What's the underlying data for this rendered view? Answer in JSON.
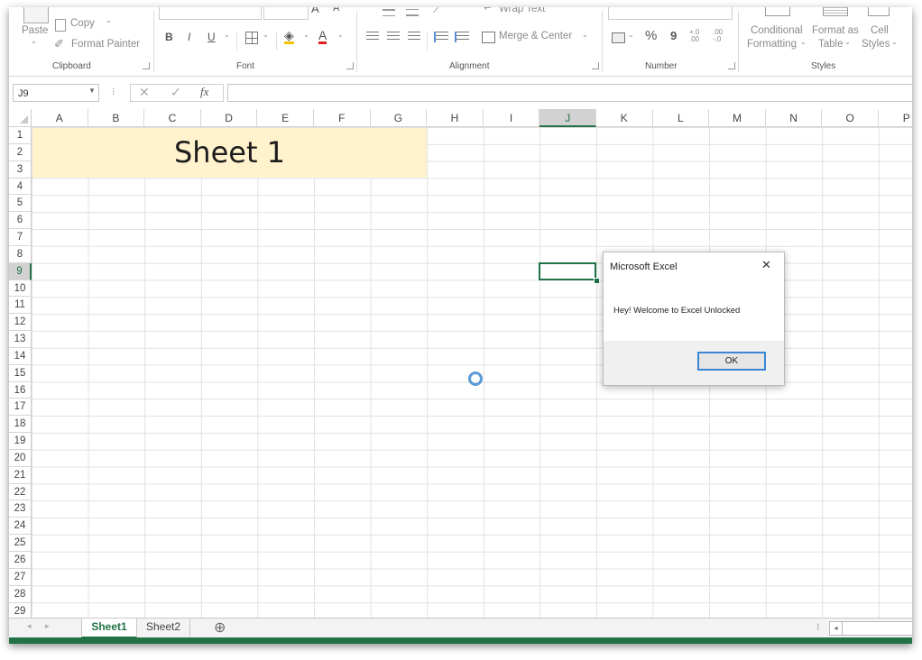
{
  "ribbon": {
    "clipboard": {
      "paste": "Paste",
      "copy": "Copy",
      "format_painter": "Format Painter",
      "group": "Clipboard"
    },
    "font": {
      "bold": "B",
      "italic": "I",
      "underline": "U",
      "group": "Font"
    },
    "alignment": {
      "wrap_text": "Wrap Text",
      "merge_center": "Merge & Center",
      "group": "Alignment"
    },
    "number": {
      "percent": "%",
      "comma": "9",
      "inc_decimal": "+.0 .00",
      "dec_decimal": ".00 -.0",
      "group": "Number"
    },
    "styles": {
      "conditional_l1": "Conditional",
      "conditional_l2": "Formatting",
      "format_table_l1": "Format as",
      "format_table_l2": "Table",
      "cell_styles_l1": "Cell",
      "cell_styles_l2": "Styles",
      "group": "Styles"
    }
  },
  "formula_bar": {
    "name_box": "J9",
    "fx": "fx",
    "formula": ""
  },
  "columns": [
    "A",
    "B",
    "C",
    "D",
    "E",
    "F",
    "G",
    "H",
    "I",
    "J",
    "K",
    "L",
    "M",
    "N",
    "O",
    "P"
  ],
  "rows": [
    "1",
    "2",
    "3",
    "4",
    "5",
    "6",
    "7",
    "8",
    "9",
    "10",
    "11",
    "12",
    "13",
    "14",
    "15",
    "16",
    "17",
    "18",
    "19",
    "20",
    "21",
    "22",
    "23",
    "24",
    "25",
    "26",
    "27",
    "28",
    "29"
  ],
  "selected_cell": {
    "column": "J",
    "row": "9"
  },
  "merged_title": {
    "text": "Sheet 1",
    "fill": "#fff2cc"
  },
  "dialog": {
    "title": "Microsoft Excel",
    "close": "✕",
    "message": "Hey! Welcome to Excel Unlocked",
    "ok": "OK"
  },
  "sheets": [
    {
      "name": "Sheet1",
      "active": true
    },
    {
      "name": "Sheet2",
      "active": false
    }
  ],
  "add_sheet": "⊕",
  "colors": {
    "excel_green": "#217346",
    "accent_blue": "#3a86d6",
    "title_fill": "#fff2cc"
  }
}
